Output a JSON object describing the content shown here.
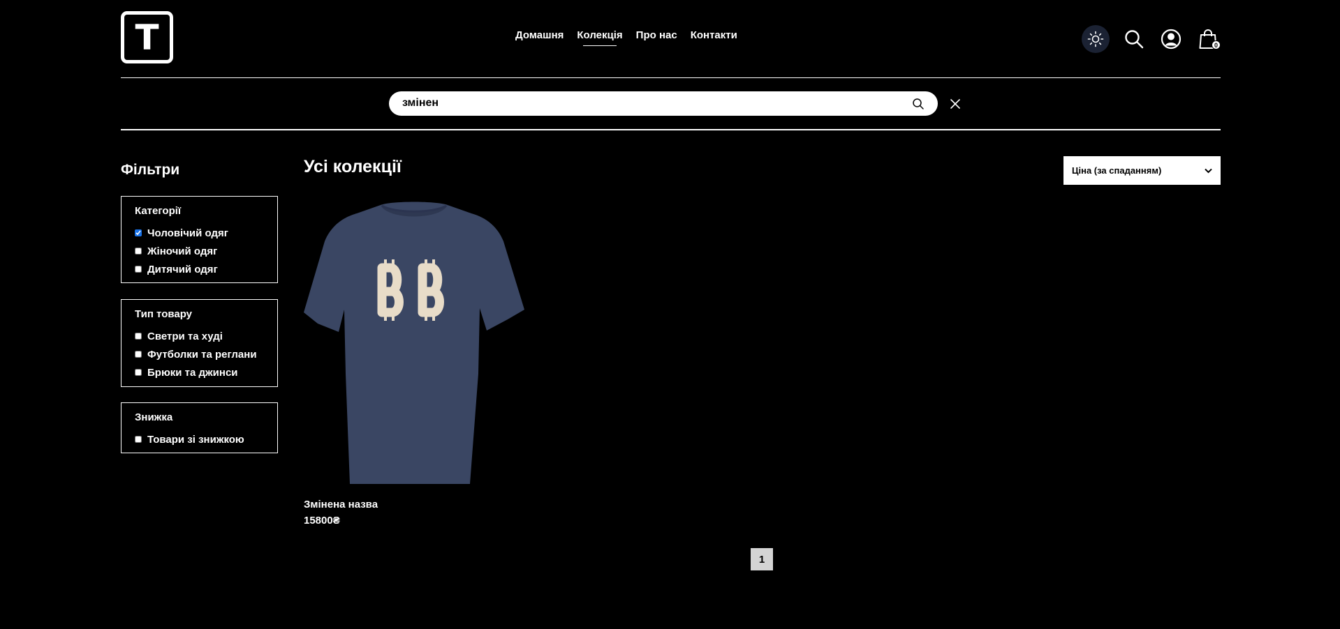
{
  "header": {
    "logo_letter": "T",
    "nav": [
      {
        "label": "Домашня",
        "active": false
      },
      {
        "label": "Колекція",
        "active": true
      },
      {
        "label": "Про нас",
        "active": false
      },
      {
        "label": "Контакти",
        "active": false
      }
    ],
    "cart_count": "0",
    "icons": [
      "sun-icon",
      "search-icon",
      "user-icon",
      "shopping-bag-icon"
    ]
  },
  "search": {
    "value": "змінен"
  },
  "filters": {
    "title": "Фільтри",
    "groups": [
      {
        "title": "Категорії",
        "options": [
          {
            "label": "Чоловічий одяг",
            "checked": true
          },
          {
            "label": "Жіночий одяг",
            "checked": false
          },
          {
            "label": "Дитячий одяг",
            "checked": false
          }
        ]
      },
      {
        "title": "Тип товару",
        "options": [
          {
            "label": "Светри та худі",
            "checked": false
          },
          {
            "label": "Футболки та реглани",
            "checked": false
          },
          {
            "label": "Брюки та джинси",
            "checked": false
          }
        ]
      },
      {
        "title": "Знижка",
        "options": [
          {
            "label": "Товари зі знижкою",
            "checked": false
          }
        ]
      }
    ]
  },
  "main": {
    "title": "Усі колекції",
    "sort_selected": "Ціна (за спаданням)",
    "products": [
      {
        "name": "Змінена назва",
        "price": "15800₴"
      }
    ],
    "pagination": {
      "current": "1"
    }
  },
  "colors": {
    "background": "#000000",
    "accent_theme_btn": "#1b2233",
    "shirt": "#3a4663",
    "shirt_logo": "#e8dcc8"
  }
}
